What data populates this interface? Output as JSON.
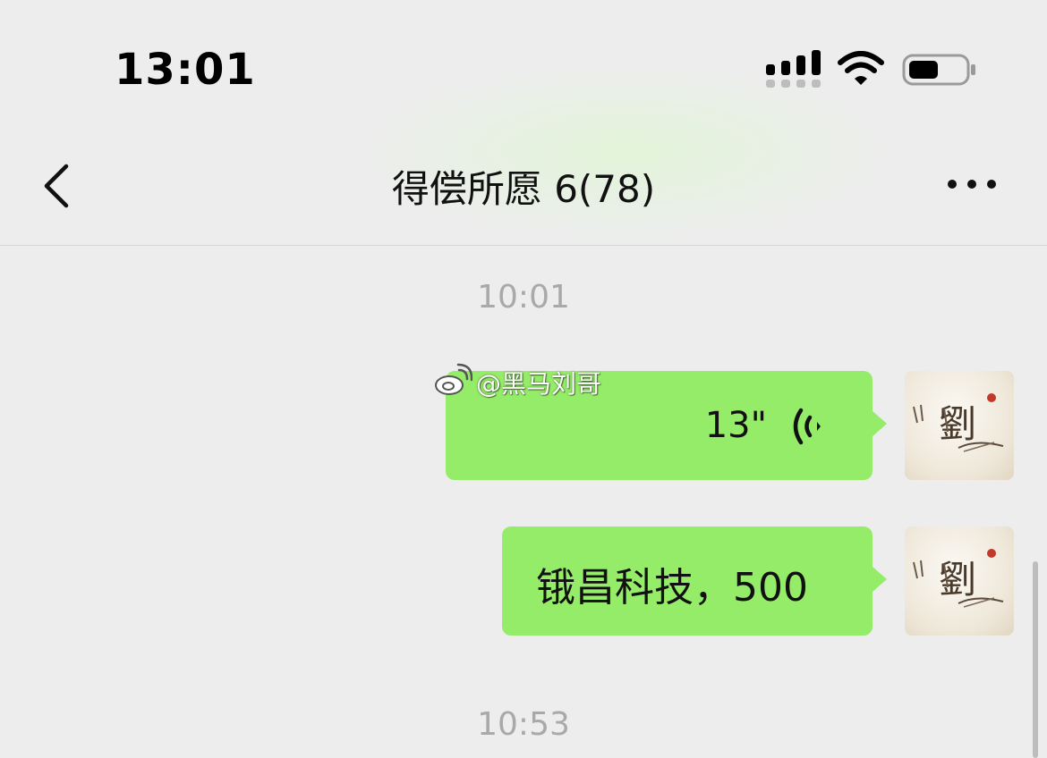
{
  "status_bar": {
    "time": "13:01",
    "signal_icon": "cellular-signal-icon",
    "wifi_icon": "wifi-icon",
    "battery_icon": "battery-icon"
  },
  "nav": {
    "title": "得偿所愿 6(78)",
    "back_icon": "chevron-left-icon",
    "more_icon": "more-dots-icon"
  },
  "messages": {
    "timestamp_1": "10:01",
    "voice": {
      "duration": "13\"",
      "icon": "voice-wave-icon"
    },
    "text": "锇昌科技，500",
    "timestamp_2": "10:53"
  },
  "watermark": {
    "text": "@黑马刘哥",
    "icon": "weibo-icon"
  },
  "avatar": {
    "glyph": "劉"
  },
  "colors": {
    "bubble": "#95ec69",
    "background": "#ededed",
    "timestamp": "#a9a9a9",
    "avatar_seal": "#c0392b"
  }
}
